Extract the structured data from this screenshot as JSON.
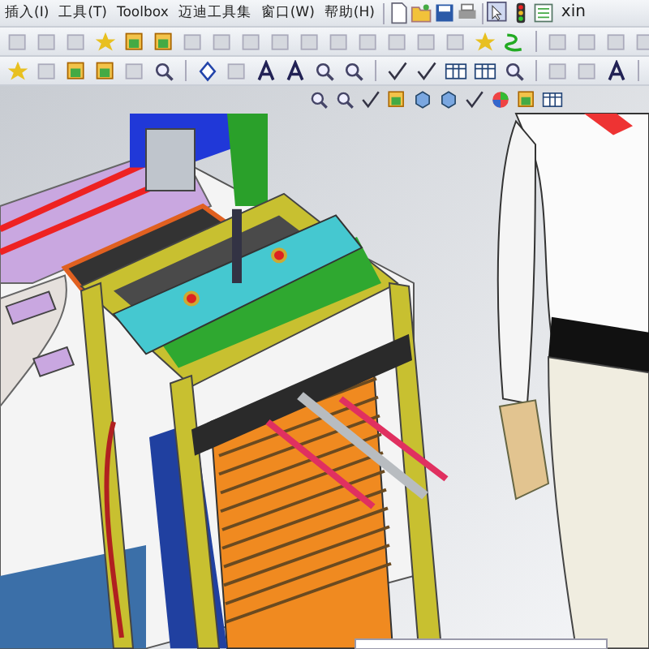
{
  "menu": [
    {
      "label": "插入(I)"
    },
    {
      "label": "工具(T)"
    },
    {
      "label": "Toolbox"
    },
    {
      "label": "迈迪工具集"
    },
    {
      "label": "窗口(W)"
    },
    {
      "label": "帮助(H)"
    }
  ],
  "toolbar_text": "xin"
}
